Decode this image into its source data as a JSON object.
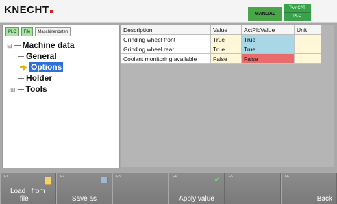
{
  "header": {
    "logo": "KNECHT",
    "mode": "MANUAL",
    "twincat_line1": "TwinCAT",
    "twincat_line2": "PLC"
  },
  "left_panel": {
    "tags": [
      "PLC",
      "File",
      "Maschinendaten"
    ],
    "tree": {
      "root": "Machine data",
      "children": [
        "General",
        "Options",
        "Holder",
        "Tools"
      ],
      "selected": "Options"
    }
  },
  "table": {
    "headers": [
      "Description",
      "Value",
      "ActPlcValue",
      "Unit"
    ],
    "rows": [
      {
        "description": "Grinding wheel front",
        "value": "True",
        "act": "True",
        "unit": ""
      },
      {
        "description": "Grinding wheel rear",
        "value": "True",
        "act": "True",
        "unit": ""
      },
      {
        "description": "Coolant monitoring available",
        "value": "False",
        "act": "False",
        "unit": ""
      }
    ]
  },
  "footer": {
    "keys": [
      {
        "num": "F1",
        "label": "Load   from\nfile",
        "icon": "file-icon"
      },
      {
        "num": "F2",
        "label": "Save as",
        "icon": "save-icon"
      },
      {
        "num": "F3",
        "label": ""
      },
      {
        "num": "F4",
        "label": "Apply value",
        "icon": "check-icon"
      },
      {
        "num": "F5",
        "label": ""
      },
      {
        "num": "F6",
        "label": "Back"
      }
    ]
  },
  "colors": {
    "plc_ok": "#a8d8e6",
    "plc_mismatch": "#e86c6c",
    "value_cell": "#fff7d8",
    "selection": "#2f6fd8",
    "mode_badge": "#4aa44a"
  }
}
